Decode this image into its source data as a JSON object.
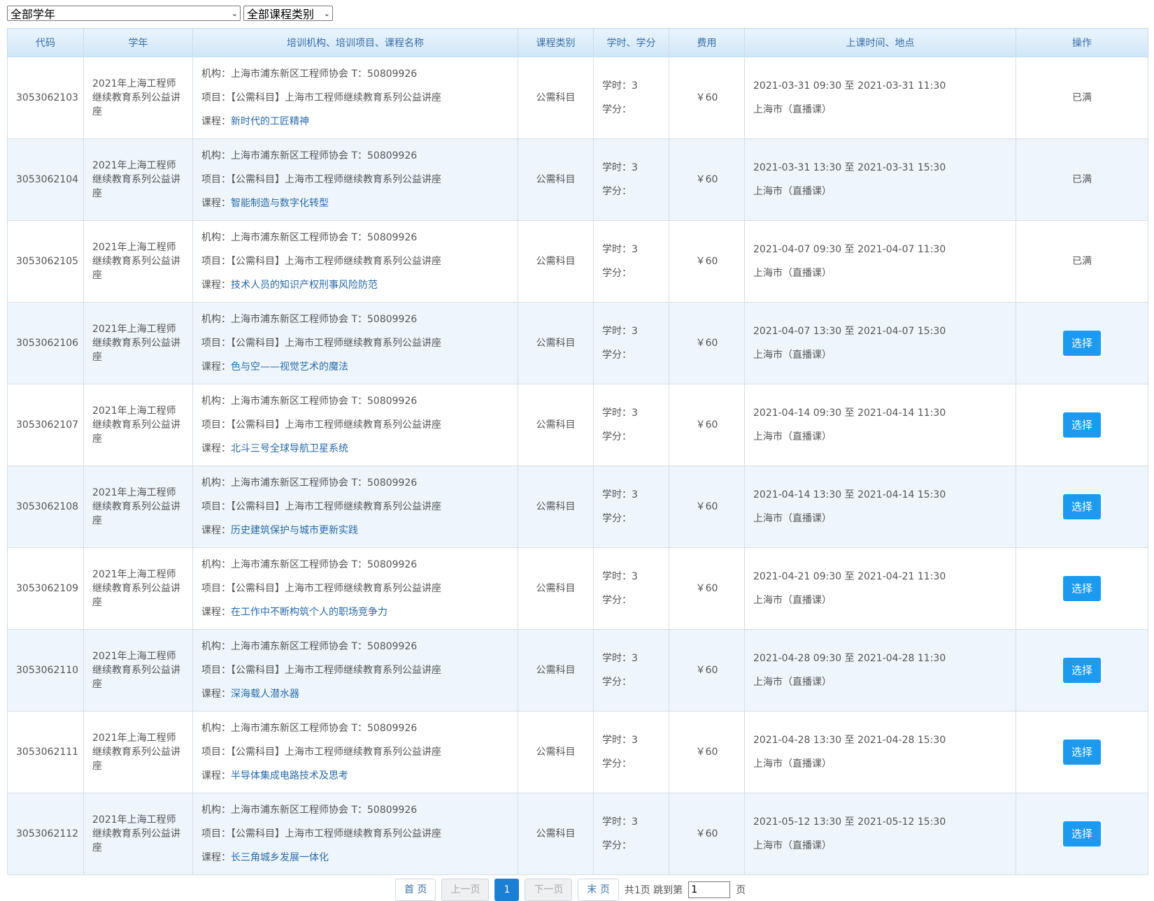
{
  "filters": {
    "year_select": "全部学年",
    "category_select": "全部课程类别"
  },
  "table": {
    "headers": [
      "代码",
      "学年",
      "培训机构、培训项目、课程名称",
      "课程类别",
      "学时、学分",
      "费用",
      "上课时间、地点",
      "操作"
    ],
    "labels": {
      "org": "机构：",
      "project": "项目：",
      "course": "课程：",
      "hours": "学时：",
      "credits": "学分：",
      "to": "至"
    },
    "rows": [
      {
        "code": "3053062103",
        "year": "2021年上海工程师继续教育系列公益讲座",
        "org": "上海市浦东新区工程师协会 T：50809926",
        "project": "【公需科目】上海市工程师继续教育系列公益讲座",
        "course": "新时代的工匠精神",
        "category": "公需科目",
        "hours": "3",
        "credits": "",
        "fee": "￥60",
        "start": "2021-03-31 09:30",
        "end": "2021-03-31 11:30",
        "location": "上海市（直播课）",
        "action": "已满",
        "selectable": false
      },
      {
        "code": "3053062104",
        "year": "2021年上海工程师继续教育系列公益讲座",
        "org": "上海市浦东新区工程师协会 T：50809926",
        "project": "【公需科目】上海市工程师继续教育系列公益讲座",
        "course": "智能制造与数字化转型",
        "category": "公需科目",
        "hours": "3",
        "credits": "",
        "fee": "￥60",
        "start": "2021-03-31 13:30",
        "end": "2021-03-31 15:30",
        "location": "上海市（直播课）",
        "action": "已满",
        "selectable": false
      },
      {
        "code": "3053062105",
        "year": "2021年上海工程师继续教育系列公益讲座",
        "org": "上海市浦东新区工程师协会 T：50809926",
        "project": "【公需科目】上海市工程师继续教育系列公益讲座",
        "course": "技术人员的知识产权刑事风险防范",
        "category": "公需科目",
        "hours": "3",
        "credits": "",
        "fee": "￥60",
        "start": "2021-04-07 09:30",
        "end": "2021-04-07 11:30",
        "location": "上海市（直播课）",
        "action": "已满",
        "selectable": false
      },
      {
        "code": "3053062106",
        "year": "2021年上海工程师继续教育系列公益讲座",
        "org": "上海市浦东新区工程师协会 T：50809926",
        "project": "【公需科目】上海市工程师继续教育系列公益讲座",
        "course": "色与空——视觉艺术的魔法",
        "category": "公需科目",
        "hours": "3",
        "credits": "",
        "fee": "￥60",
        "start": "2021-04-07 13:30",
        "end": "2021-04-07 15:30",
        "location": "上海市（直播课）",
        "action": "选择",
        "selectable": true
      },
      {
        "code": "3053062107",
        "year": "2021年上海工程师继续教育系列公益讲座",
        "org": "上海市浦东新区工程师协会 T：50809926",
        "project": "【公需科目】上海市工程师继续教育系列公益讲座",
        "course": "北斗三号全球导航卫星系统",
        "category": "公需科目",
        "hours": "3",
        "credits": "",
        "fee": "￥60",
        "start": "2021-04-14 09:30",
        "end": "2021-04-14 11:30",
        "location": "上海市（直播课）",
        "action": "选择",
        "selectable": true
      },
      {
        "code": "3053062108",
        "year": "2021年上海工程师继续教育系列公益讲座",
        "org": "上海市浦东新区工程师协会 T：50809926",
        "project": "【公需科目】上海市工程师继续教育系列公益讲座",
        "course": "历史建筑保护与城市更新实践",
        "category": "公需科目",
        "hours": "3",
        "credits": "",
        "fee": "￥60",
        "start": "2021-04-14 13:30",
        "end": "2021-04-14 15:30",
        "location": "上海市（直播课）",
        "action": "选择",
        "selectable": true
      },
      {
        "code": "3053062109",
        "year": "2021年上海工程师继续教育系列公益讲座",
        "org": "上海市浦东新区工程师协会 T：50809926",
        "project": "【公需科目】上海市工程师继续教育系列公益讲座",
        "course": "在工作中不断构筑个人的职场竞争力",
        "category": "公需科目",
        "hours": "3",
        "credits": "",
        "fee": "￥60",
        "start": "2021-04-21 09:30",
        "end": "2021-04-21 11:30",
        "location": "上海市（直播课）",
        "action": "选择",
        "selectable": true
      },
      {
        "code": "3053062110",
        "year": "2021年上海工程师继续教育系列公益讲座",
        "org": "上海市浦东新区工程师协会 T：50809926",
        "project": "【公需科目】上海市工程师继续教育系列公益讲座",
        "course": "深海载人潜水器",
        "category": "公需科目",
        "hours": "3",
        "credits": "",
        "fee": "￥60",
        "start": "2021-04-28 09:30",
        "end": "2021-04-28 11:30",
        "location": "上海市（直播课）",
        "action": "选择",
        "selectable": true
      },
      {
        "code": "3053062111",
        "year": "2021年上海工程师继续教育系列公益讲座",
        "org": "上海市浦东新区工程师协会 T：50809926",
        "project": "【公需科目】上海市工程师继续教育系列公益讲座",
        "course": "半导体集成电路技术及思考",
        "category": "公需科目",
        "hours": "3",
        "credits": "",
        "fee": "￥60",
        "start": "2021-04-28 13:30",
        "end": "2021-04-28 15:30",
        "location": "上海市（直播课）",
        "action": "选择",
        "selectable": true
      },
      {
        "code": "3053062112",
        "year": "2021年上海工程师继续教育系列公益讲座",
        "org": "上海市浦东新区工程师协会 T：50809926",
        "project": "【公需科目】上海市工程师继续教育系列公益讲座",
        "course": "长三角城乡发展一体化",
        "category": "公需科目",
        "hours": "3",
        "credits": "",
        "fee": "￥60",
        "start": "2021-05-12 13:30",
        "end": "2021-05-12 15:30",
        "location": "上海市（直播课）",
        "action": "选择",
        "selectable": true
      }
    ]
  },
  "pager": {
    "first": "首 页",
    "prev": "上一页",
    "current": "1",
    "next": "下一页",
    "last": "末 页",
    "total_text": "共1页 跳到第",
    "jump_value": "1",
    "page_suffix": "页"
  },
  "colors": {
    "accent": "#1b9af0",
    "header_text": "#3a6ea5",
    "row_alt": "#eef6fc"
  }
}
